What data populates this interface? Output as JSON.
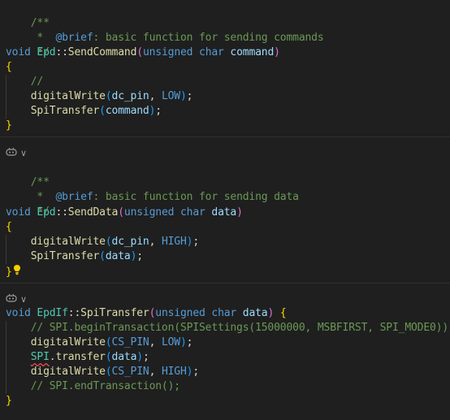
{
  "editor": {
    "background": "#1f1f1f",
    "blocks": [
      {
        "comment": [
          "/**",
          " *  @brief: basic function for sending commands",
          " */"
        ],
        "signature": {
          "ret": "void",
          "cls": "Epd",
          "sep": "::",
          "fn": "SendCommand",
          "open": "(",
          "ptype": "unsigned char",
          "pname": "command",
          "close": ")"
        },
        "open_brace": "{",
        "body": [
          "//",
          "digitalWrite(dc_pin, LOW);",
          "SpiTransfer(command);"
        ],
        "close_brace": "}"
      },
      {
        "codelens_icon": "copilot-icon",
        "codelens_chevron": "∨",
        "comment": [
          "/**",
          " *  @brief: basic function for sending data",
          " */"
        ],
        "signature": {
          "ret": "void",
          "cls": "Epd",
          "sep": "::",
          "fn": "SendData",
          "open": "(",
          "ptype": "unsigned char",
          "pname": "data",
          "close": ")"
        },
        "open_brace": "{",
        "body": [
          "digitalWrite(dc_pin, HIGH);",
          "SpiTransfer(data);"
        ],
        "close_brace": "}",
        "lightbulb_icon": "lightbulb-icon"
      },
      {
        "codelens_icon": "copilot-icon",
        "codelens_chevron": "∨",
        "signature": {
          "ret": "void",
          "cls": "EpdIf",
          "sep": "::",
          "fn": "SpiTransfer",
          "open": "(",
          "ptype": "unsigned char",
          "pname": "data",
          "close": ")",
          "brace": "{"
        },
        "body": [
          "// SPI.beginTransaction(SPISettings(15000000, MSBFIRST, SPI_MODE0));",
          "digitalWrite(CS_PIN, LOW);",
          "SPI.transfer(data);",
          "digitalWrite(CS_PIN, HIGH);",
          "// SPI.endTransaction();"
        ],
        "close_brace": "}"
      }
    ],
    "colors": {
      "comment": "#6a9955",
      "keyword": "#569cd6",
      "type": "#4ec9b0",
      "function": "#dcdcaa",
      "parameter": "#9cdcfe",
      "brace": "#ffd700",
      "paren": "#da70d6",
      "error_squiggle": "#f14c4c"
    }
  }
}
